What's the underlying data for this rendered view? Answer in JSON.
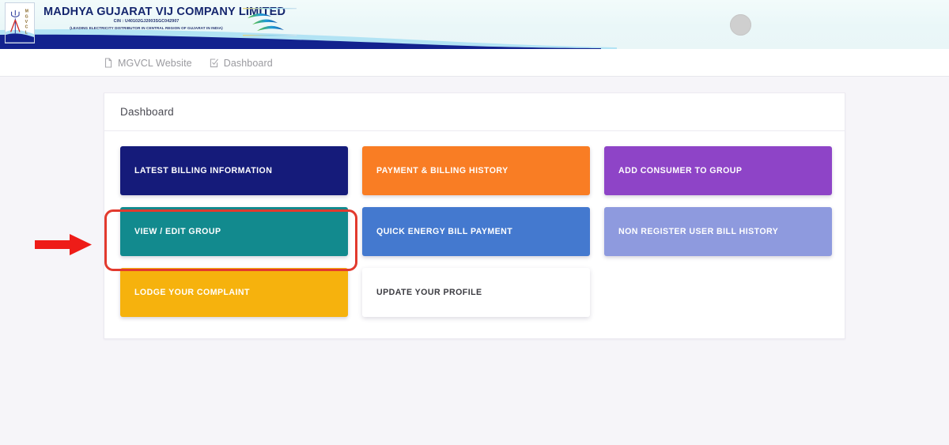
{
  "header": {
    "org_title": "MADHYA GUJARAT VIJ COMPANY LIMITED",
    "cin": "CIN : U40102GJ2003SGC042907",
    "tagline": "(LEADING ELECTRICITY DISTRIBUTOR IN  CENTRAL    REGION OF GUJARAT IN INDIA)",
    "logo_text": "MGVCL",
    "avatar_label": ""
  },
  "navbar": {
    "items": [
      {
        "label": "MGVCL Website",
        "icon": "document-icon"
      },
      {
        "label": "Dashboard",
        "icon": "checkbox-icon"
      }
    ]
  },
  "panel": {
    "title": "Dashboard",
    "tiles": [
      {
        "label": "LATEST BILLING INFORMATION",
        "color": "#151b7a",
        "text_color": "#ffffff",
        "name": "latest-billing-information"
      },
      {
        "label": "PAYMENT & BILLING HISTORY",
        "color": "#f97d24",
        "text_color": "#ffffff",
        "name": "payment-billing-history"
      },
      {
        "label": "ADD CONSUMER TO GROUP",
        "color": "#8e44c7",
        "text_color": "#ffffff",
        "name": "add-consumer-to-group"
      },
      {
        "label": "VIEW / EDIT GROUP",
        "color": "#128a8e",
        "text_color": "#ffffff",
        "name": "view-edit-group"
      },
      {
        "label": "QUICK ENERGY BILL PAYMENT",
        "color": "#4479cf",
        "text_color": "#ffffff",
        "name": "quick-energy-bill-payment"
      },
      {
        "label": "NON REGISTER USER BILL HISTORY",
        "color": "#8e9ade",
        "text_color": "#ffffff",
        "name": "non-register-user-bill-history"
      },
      {
        "label": "LODGE YOUR COMPLAINT",
        "color": "#f6b20d",
        "text_color": "#ffffff",
        "name": "lodge-your-complaint"
      },
      {
        "label": "UPDATE YOUR PROFILE",
        "color": "#ffffff",
        "text_color": "#3b3b41",
        "name": "update-your-profile"
      }
    ]
  },
  "annotations": {
    "highlight_color": "#e23a2e",
    "arrow_color": "#ee1c18",
    "highlight_target": "LATEST BILLING INFORMATION"
  }
}
